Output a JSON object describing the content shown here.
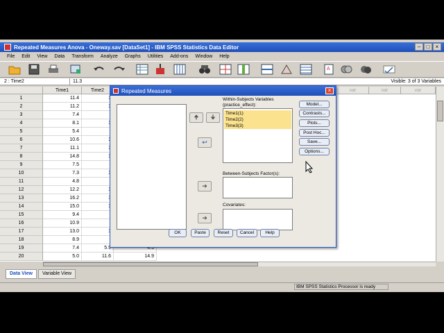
{
  "window": {
    "title": "Repeated Measures Anova - Oneway.sav [DataSet1] - IBM SPSS Statistics Data Editor"
  },
  "menu": [
    "File",
    "Edit",
    "View",
    "Data",
    "Transform",
    "Analyze",
    "Graphs",
    "Utilities",
    "Add-ons",
    "Window",
    "Help"
  ],
  "cell": {
    "ref": "2 : Time2",
    "value": "11.3",
    "visible": "Visible: 3 of 3 Variables"
  },
  "grid": {
    "columns": [
      "Time1",
      "Time2"
    ],
    "dim_columns": [
      "var",
      "var",
      "var"
    ],
    "rows": [
      {
        "n": "1",
        "t1": "11.4",
        "t2": "1"
      },
      {
        "n": "2",
        "t1": "11.2",
        "t2": "1"
      },
      {
        "n": "3",
        "t1": "7.4",
        "t2": ""
      },
      {
        "n": "4",
        "t1": "8.1",
        "t2": "1"
      },
      {
        "n": "5",
        "t1": "5.4",
        "t2": ""
      },
      {
        "n": "6",
        "t1": "10.6",
        "t2": "1"
      },
      {
        "n": "7",
        "t1": "11.1",
        "t2": "1"
      },
      {
        "n": "8",
        "t1": "14.8",
        "t2": "1"
      },
      {
        "n": "9",
        "t1": "7.5",
        "t2": ""
      },
      {
        "n": "10",
        "t1": "7.3",
        "t2": "1"
      },
      {
        "n": "11",
        "t1": "4.8",
        "t2": ""
      },
      {
        "n": "12",
        "t1": "12.2",
        "t2": "1"
      },
      {
        "n": "13",
        "t1": "16.2",
        "t2": "1"
      },
      {
        "n": "14",
        "t1": "15.0",
        "t2": "1"
      },
      {
        "n": "15",
        "t1": "9.4",
        "t2": ""
      },
      {
        "n": "16",
        "t1": "10.9",
        "t2": ""
      },
      {
        "n": "17",
        "t1": "13.0",
        "t2": "1"
      },
      {
        "n": "18",
        "t1": "8.9",
        "t2": ""
      },
      {
        "n": "19",
        "t1": "7.4",
        "t2": "5.9",
        "t3": "4.5"
      },
      {
        "n": "20",
        "t1": "5.0",
        "t2": "11.6",
        "t3": "14.9"
      }
    ]
  },
  "tabs": {
    "data_view": "Data View",
    "variable_view": "Variable View"
  },
  "status": "IBM SPSS Statistics Processor is ready",
  "dialog": {
    "title": "Repeated Measures",
    "within_label_1": "Within-Subjects Variables",
    "within_label_2": "(practice_effect):",
    "within_items": [
      "Time1(1)",
      "Time2(2)",
      "Time3(3)"
    ],
    "between_label": "Between-Subjects Factor(s):",
    "covariates_label": "Covariates:",
    "side_buttons": [
      "Model...",
      "Contrasts...",
      "Plots...",
      "Post Hoc...",
      "Save...",
      "Options..."
    ],
    "bottom_buttons": [
      "OK",
      "Paste",
      "Reset",
      "Cancel",
      "Help"
    ]
  },
  "colors": {
    "selection": "#fbe28f",
    "titlebar": "#1f4fb8"
  }
}
